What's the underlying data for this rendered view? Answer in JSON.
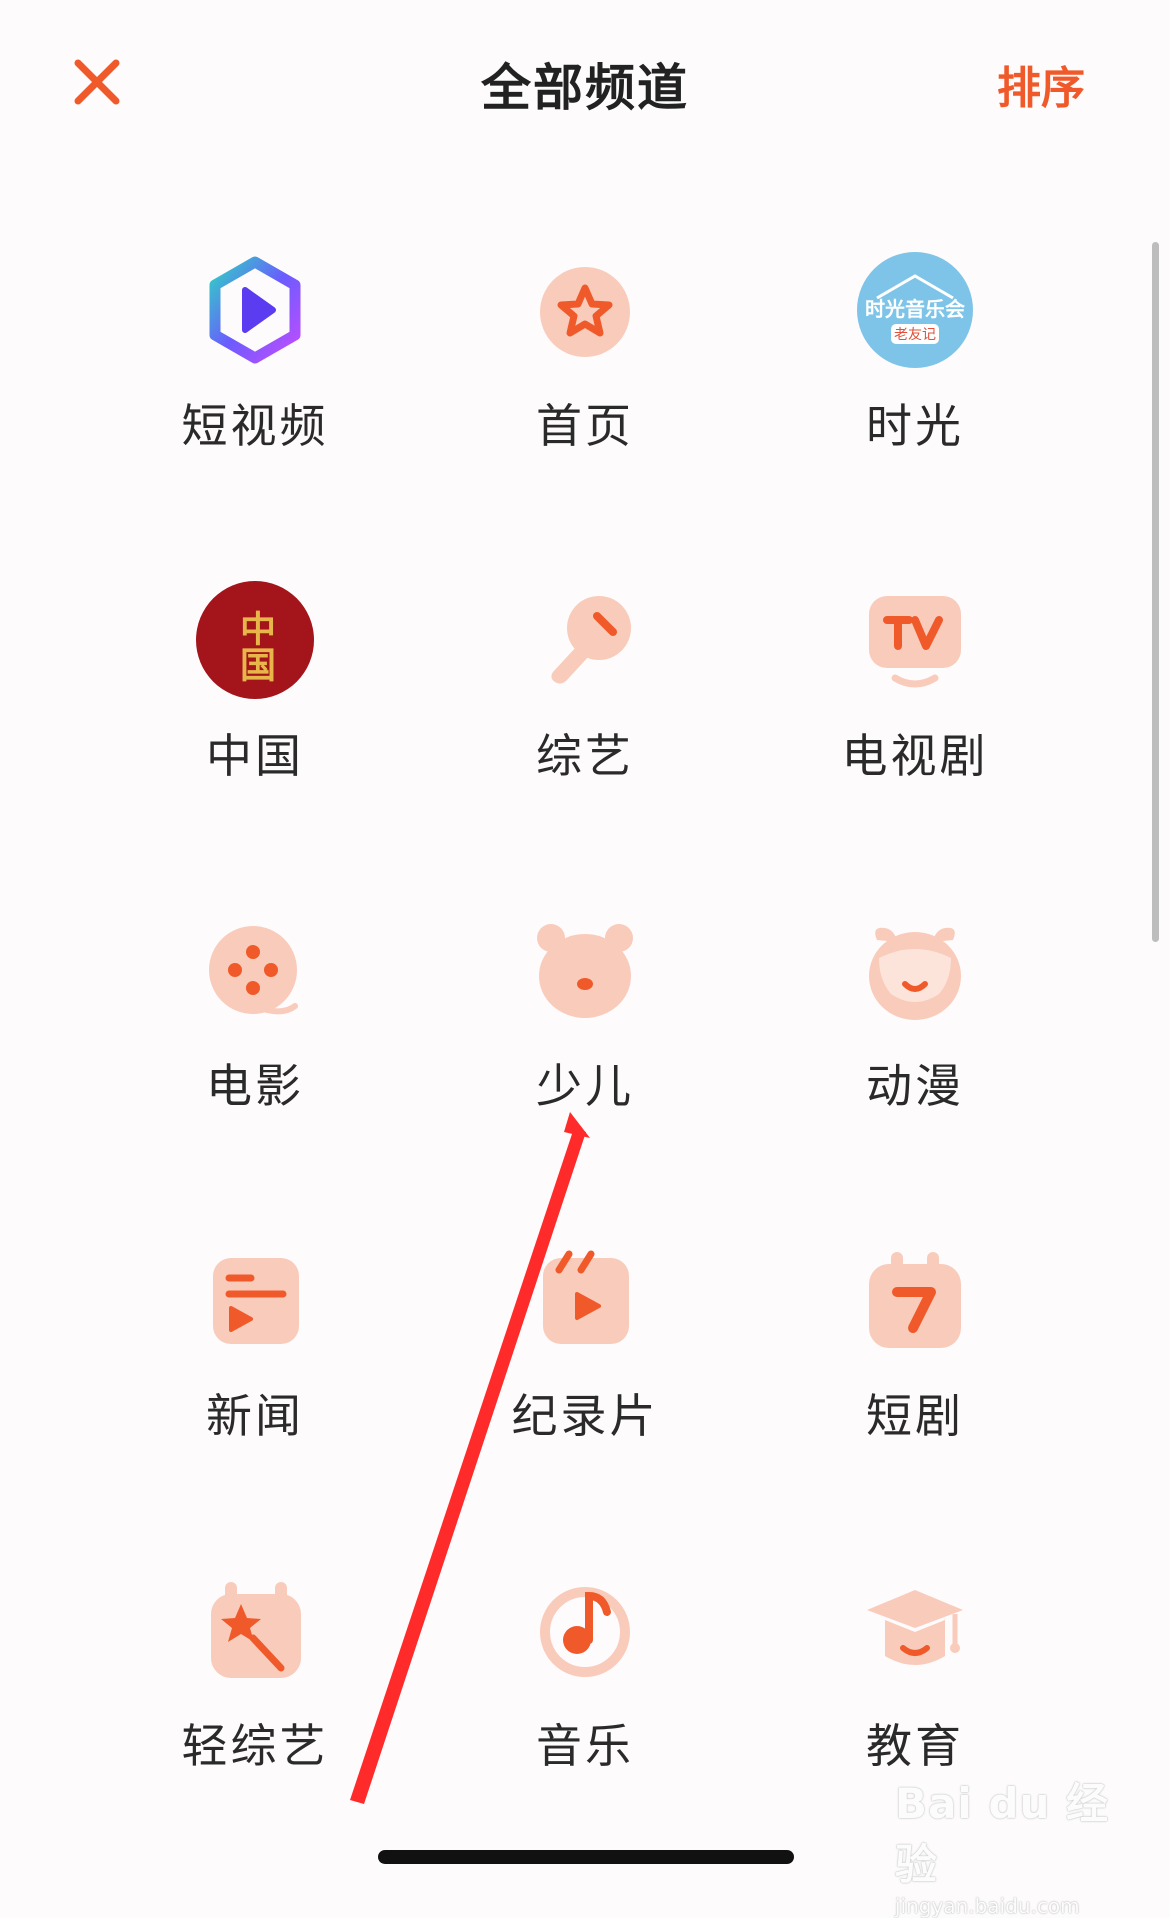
{
  "header": {
    "title": "全部频道",
    "sort_label": "排序"
  },
  "channels": [
    {
      "label": "短视频",
      "icon": "short-video-icon"
    },
    {
      "label": "首页",
      "icon": "home-star-icon"
    },
    {
      "label": "时光",
      "icon": "time-concert-logo"
    },
    {
      "label": "中国",
      "icon": "china-logo"
    },
    {
      "label": "综艺",
      "icon": "microphone-icon"
    },
    {
      "label": "电视剧",
      "icon": "tv-icon"
    },
    {
      "label": "电影",
      "icon": "film-reel-icon"
    },
    {
      "label": "少儿",
      "icon": "bear-icon"
    },
    {
      "label": "动漫",
      "icon": "cartoon-face-icon"
    },
    {
      "label": "新闻",
      "icon": "news-icon"
    },
    {
      "label": "纪录片",
      "icon": "clapper-icon"
    },
    {
      "label": "短剧",
      "icon": "short-drama-icon"
    },
    {
      "label": "轻综艺",
      "icon": "magic-wand-icon"
    },
    {
      "label": "音乐",
      "icon": "music-note-icon"
    },
    {
      "label": "教育",
      "icon": "graduation-cap-icon"
    }
  ],
  "logo_text": {
    "time_logo": "时光音乐会",
    "time_logo_sub": "老友记",
    "china_logo": "中国"
  },
  "watermark": {
    "logo": "Bai du 经验",
    "url": "jingyan.baidu.com"
  },
  "colors": {
    "accent": "#f05a2a",
    "icon_bg": "#f9cbbb",
    "icon_fg": "#f05a2a",
    "title": "#222222",
    "annotation_arrow": "#ff2a2a"
  }
}
